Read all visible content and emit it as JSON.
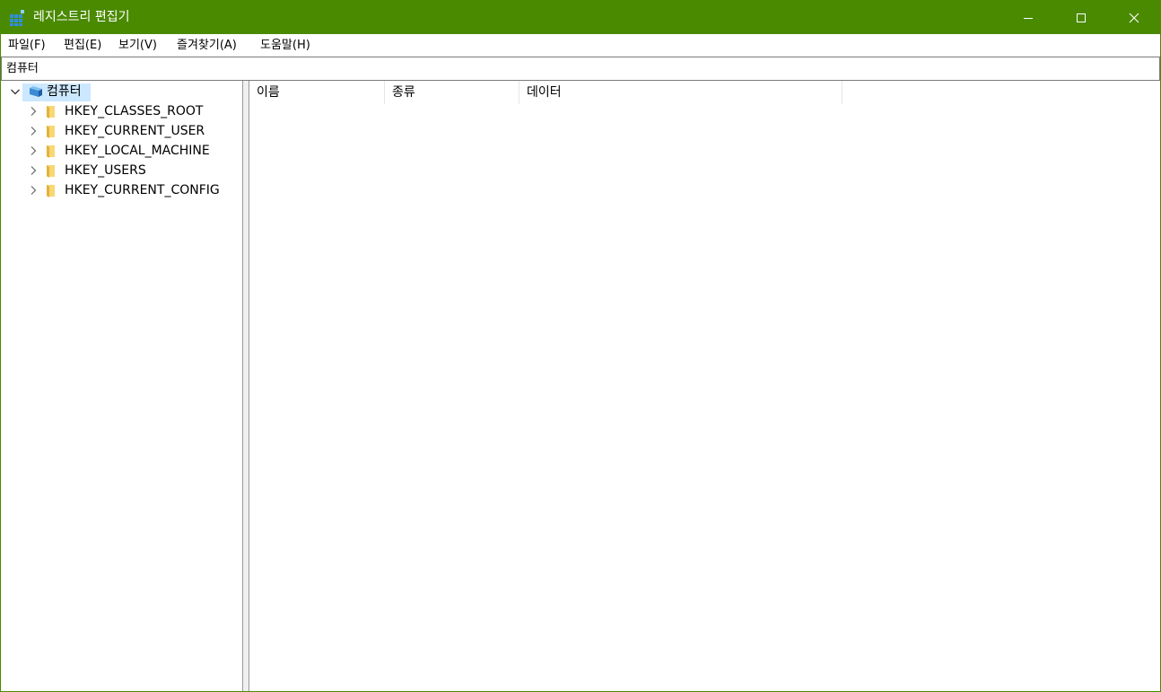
{
  "window": {
    "title": "레지스트리 편집기",
    "accent_color": "#4a8a00",
    "controls": [
      "minimize-icon",
      "maximize-icon",
      "close-icon"
    ]
  },
  "menu": {
    "items": [
      "파일(F)",
      "편집(E)",
      "보기(V)",
      "즐겨찾기(A)",
      "도움말(H)"
    ]
  },
  "address": {
    "value": "컴퓨터"
  },
  "tree": {
    "root": {
      "label": "컴퓨터",
      "icon": "computer-icon",
      "expanded": true,
      "selected": true
    },
    "hives": [
      {
        "label": "HKEY_CLASSES_ROOT",
        "icon": "folder-icon"
      },
      {
        "label": "HKEY_CURRENT_USER",
        "icon": "folder-icon"
      },
      {
        "label": "HKEY_LOCAL_MACHINE",
        "icon": "folder-icon"
      },
      {
        "label": "HKEY_USERS",
        "icon": "folder-icon"
      },
      {
        "label": "HKEY_CURRENT_CONFIG",
        "icon": "folder-icon"
      }
    ]
  },
  "list": {
    "columns": [
      "이름",
      "종류",
      "데이터"
    ]
  }
}
